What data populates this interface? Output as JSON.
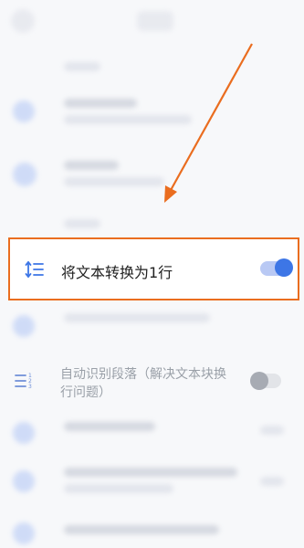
{
  "settings": {
    "convert_row": {
      "label": "将文本转换为1行",
      "toggle_on": true,
      "icon": "line-height-icon"
    },
    "paragraph_row": {
      "label": "自动识别段落（解决文本块换行问题）",
      "toggle_on": false,
      "icon": "numbered-list-icon"
    }
  },
  "annotation": {
    "highlight_color": "#ea6d1f",
    "accent_color": "#3d76e6"
  }
}
